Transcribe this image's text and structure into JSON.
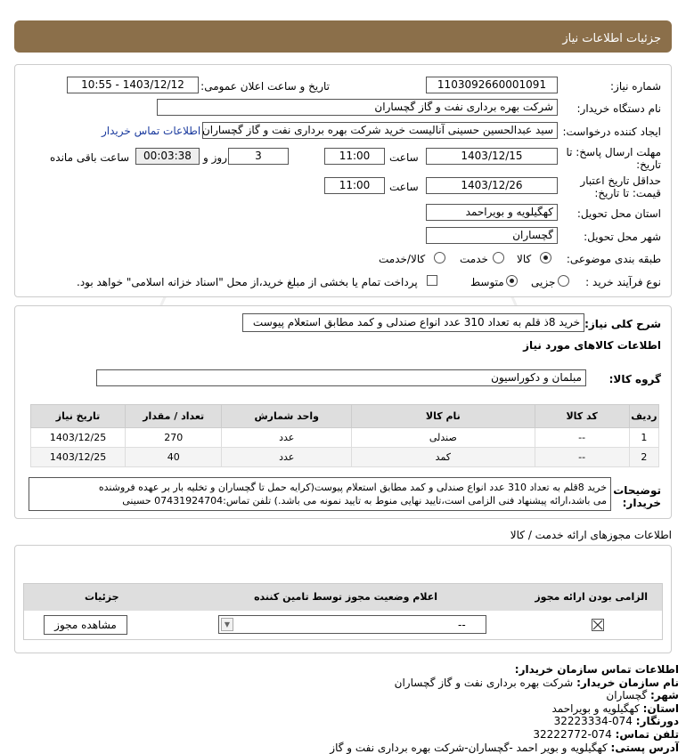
{
  "header": {
    "title": "جزئیات اطلاعات نیاز"
  },
  "form": {
    "need_number_label": "شماره نیاز:",
    "need_number": "1103092660001091",
    "announce_label": "تاریخ و ساعت اعلان عمومی:",
    "announce_value": "1403/12/12 - 10:55",
    "buyer_label": "نام دستگاه خریدار:",
    "buyer_value": "شرکت بهره برداری نفت و گاز گچساران",
    "creator_label": "ایجاد کننده درخواست:",
    "creator_value": "سید عبدالحسین حسینی آنالیست خرید شرکت بهره برداری نفت و گاز گچساران",
    "contact_link": "اطلاعات تماس خریدار",
    "deadline_label": "مهلت ارسال پاسخ: تا",
    "deadline_label2": "تاریخ:",
    "deadline_date": "1403/12/15",
    "time_label": "ساعت",
    "deadline_time": "11:00",
    "days_value": "3",
    "days_label": "روز و",
    "remaining_time": "00:03:38",
    "remaining_label": "ساعت باقی مانده",
    "validity_label": "حداقل تاریخ اعتبار",
    "validity_label2": "قیمت: تا تاریخ:",
    "validity_date": "1403/12/26",
    "validity_time": "11:00",
    "province_label": "استان محل تحویل:",
    "province_value": "کهگیلویه و بویراحمد",
    "city_label": "شهر محل تحویل:",
    "city_value": "گچساران",
    "category_label": "طبقه بندی موضوعی:",
    "cat_goods": "کالا",
    "cat_service": "خدمت",
    "cat_both": "کالا/خدمت",
    "process_label": "نوع فرآیند خرید :",
    "proc_partial": "جزیی",
    "proc_medium": "متوسط",
    "proc_note": "پرداخت تمام یا بخشی از مبلغ خرید،از محل \"اسناد خزانه اسلامی\" خواهد بود."
  },
  "summary": {
    "label": "شرح کلی نیاز:",
    "value": "خرید 8ذ قلم به تعداد 310 عدد انواع صندلی و کمد مطابق استعلام پیوست"
  },
  "goods": {
    "section_title": "اطلاعات کالاهای مورد نیاز",
    "group_label": "گروه کالا:",
    "group_value": "مبلمان و دکوراسیون",
    "headers": [
      "ردیف",
      "کد کالا",
      "نام کالا",
      "واحد شمارش",
      "تعداد / مقدار",
      "تاریخ نیاز"
    ],
    "rows": [
      [
        "1",
        "--",
        "صندلی",
        "عدد",
        "270",
        "1403/12/25"
      ],
      [
        "2",
        "--",
        "کمد",
        "عدد",
        "40",
        "1403/12/25"
      ]
    ]
  },
  "notes": {
    "label1": "توضیحات",
    "label2": "خریدار:",
    "line1": "خرید 8قلم به تعداد 310 عدد انواع صندلی و کمد مطابق استعلام پیوست(کرایه حمل تا گچساران و تخلیه بار بر عهده فروشنده",
    "line2": "می باشد،ارائه پیشنهاد فنی الزامی است،تایید نهایی منوط به تایید نمونه می باشد.) تلفن تماس:07431924704 حسینی"
  },
  "permits": {
    "section_title": "اطلاعات مجوزهای ارائه خدمت / کالا",
    "col_required": "الزامی بودن ارائه مجوز",
    "col_status": "اعلام وضعیت مجوز توسط تامین کننده",
    "col_details": "جزئیات",
    "select_value": "--",
    "view_button": "مشاهده مجوز"
  },
  "contact": {
    "title": "اطلاعات تماس سازمان خریدار:",
    "org_label": "نام سازمان خریدار:",
    "org_value": "شرکت بهره برداری نفت و گاز گچساران",
    "city_label": "شهر:",
    "city_value": "گچساران",
    "prov_label": "استان:",
    "prov_value": "کهگیلویه و بویراحمد",
    "fax_label": "دورنگار:",
    "fax_value": "074-32223334",
    "phone_label": "تلفن تماس:",
    "phone_value": "074-32222772",
    "addr_label": "آدرس پستی:",
    "addr_value": "کهگیلویه و بویر احمد -گچساران-شرکت بهره برداری نفت و گاز"
  },
  "colors": {
    "header": "#8b6f4a",
    "link": "#1a3a9e"
  }
}
